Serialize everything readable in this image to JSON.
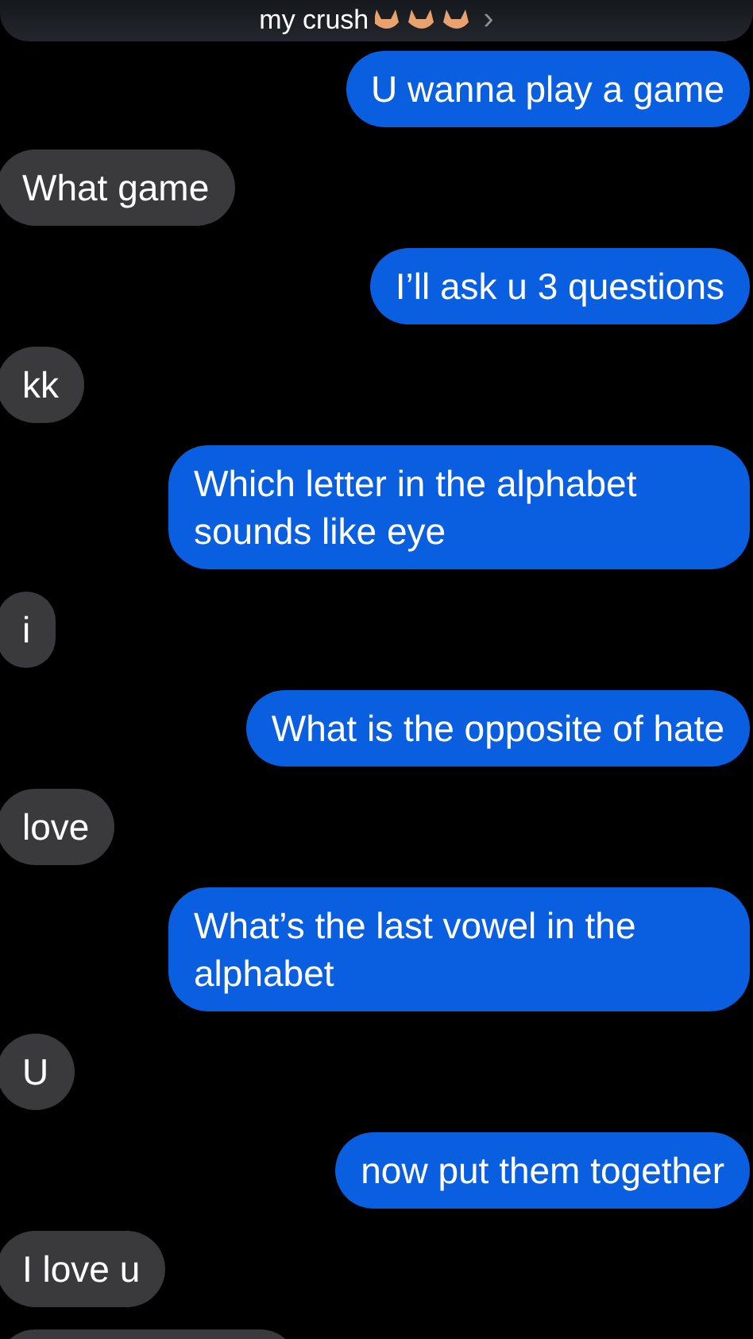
{
  "header": {
    "title": "my crush",
    "chevron": "›"
  },
  "messages": [
    {
      "kind": "sent",
      "text": "U wanna play a game"
    },
    {
      "kind": "received",
      "text": "What game"
    },
    {
      "kind": "sent",
      "text": "I’ll ask u 3 questions"
    },
    {
      "kind": "received",
      "text": "kk"
    },
    {
      "kind": "sent",
      "text": "Which letter in the alphabet sounds like eye"
    },
    {
      "kind": "received",
      "text": "i"
    },
    {
      "kind": "sent",
      "text": "What is the opposite of hate"
    },
    {
      "kind": "received",
      "text": "love"
    },
    {
      "kind": "sent",
      "text": "What’s the last vowel in the alphabet"
    },
    {
      "kind": "received",
      "text": "U"
    },
    {
      "kind": "sent",
      "text": "now put them together"
    },
    {
      "kind": "received",
      "text": "I love u"
    },
    {
      "kind": "received"
    }
  ]
}
